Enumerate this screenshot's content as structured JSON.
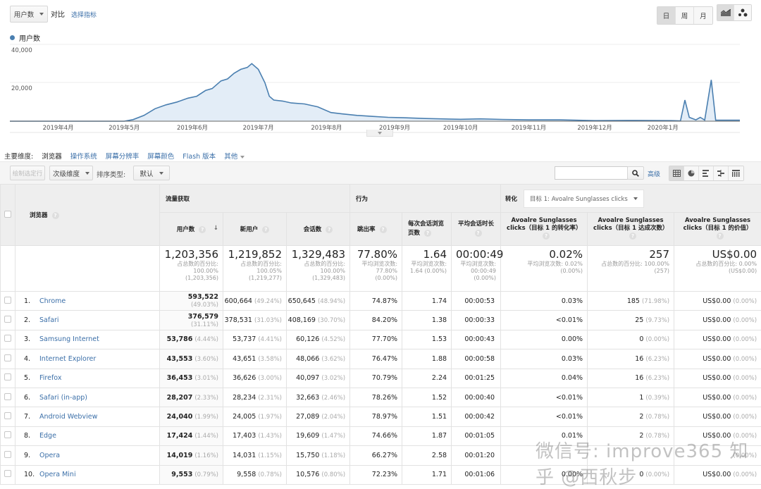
{
  "top": {
    "metric_select": "用户数",
    "compare_label": "对比",
    "select_metric_link": "选择指标",
    "period_buttons": [
      "日",
      "周",
      "月"
    ],
    "active_period": "日"
  },
  "legend": {
    "label": "用户数",
    "color": "#4a7fb0"
  },
  "chart_data": {
    "type": "area",
    "series": [
      {
        "name": "用户数",
        "color": "#4a7fb0"
      }
    ],
    "y_ticks": [
      "40,000",
      "20,000"
    ],
    "ylim": [
      0,
      40000
    ],
    "x_tick_labels": [
      "2019年4月",
      "2019年5月",
      "2019年6月",
      "2019年7月",
      "2019年8月",
      "2019年9月",
      "2019年10月",
      "2019年11月",
      "2019年12月",
      "2020年1月"
    ],
    "x_start": "2019-03-10",
    "x_end": "2020-02-05",
    "points": [
      [
        "2019-03-10",
        0
      ],
      [
        "2019-04-01",
        0
      ],
      [
        "2019-05-01",
        0
      ],
      [
        "2019-05-05",
        800
      ],
      [
        "2019-05-10",
        3000
      ],
      [
        "2019-05-15",
        6500
      ],
      [
        "2019-05-20",
        8500
      ],
      [
        "2019-05-25",
        10000
      ],
      [
        "2019-05-30",
        12000
      ],
      [
        "2019-06-03",
        13000
      ],
      [
        "2019-06-07",
        16000
      ],
      [
        "2019-06-10",
        17000
      ],
      [
        "2019-06-14",
        21000
      ],
      [
        "2019-06-17",
        22000
      ],
      [
        "2019-06-20",
        25000
      ],
      [
        "2019-06-23",
        27000
      ],
      [
        "2019-06-26",
        28000
      ],
      [
        "2019-06-28",
        30000
      ],
      [
        "2019-07-01",
        27000
      ],
      [
        "2019-07-04",
        20000
      ],
      [
        "2019-07-06",
        13000
      ],
      [
        "2019-07-08",
        11000
      ],
      [
        "2019-07-12",
        10500
      ],
      [
        "2019-07-16",
        9500
      ],
      [
        "2019-07-22",
        9000
      ],
      [
        "2019-07-28",
        7500
      ],
      [
        "2019-08-03",
        4500
      ],
      [
        "2019-08-08",
        3800
      ],
      [
        "2019-08-15",
        3000
      ],
      [
        "2019-08-22",
        2500
      ],
      [
        "2019-08-29",
        2000
      ],
      [
        "2019-09-05",
        1800
      ],
      [
        "2019-09-15",
        1400
      ],
      [
        "2019-10-01",
        1000
      ],
      [
        "2019-10-10",
        1200
      ],
      [
        "2019-10-20",
        900
      ],
      [
        "2019-11-01",
        700
      ],
      [
        "2019-11-15",
        700
      ],
      [
        "2019-12-01",
        300
      ],
      [
        "2019-12-20",
        400
      ],
      [
        "2020-01-05",
        300
      ],
      [
        "2020-01-09",
        200
      ],
      [
        "2020-01-11",
        11000
      ],
      [
        "2020-01-13",
        2000
      ],
      [
        "2020-01-16",
        700
      ],
      [
        "2020-01-18",
        2000
      ],
      [
        "2020-01-20",
        600
      ],
      [
        "2020-01-23",
        21500
      ],
      [
        "2020-01-25",
        500
      ],
      [
        "2020-02-05",
        500
      ]
    ]
  },
  "dimensions": {
    "label": "主要维度:",
    "items": [
      "浏览器",
      "操作系统",
      "屏幕分辨率",
      "屏幕颜色",
      "Flash 版本",
      "其他"
    ],
    "active": "浏览器"
  },
  "toolbar": {
    "plot_rows": "绘制选定行",
    "secondary_dim": "次级维度",
    "sort_label": "排序类型:",
    "sort_value": "默认",
    "search_placeholder": "",
    "advanced": "高级"
  },
  "table": {
    "dimension_header": "浏览器",
    "groups": {
      "acquisition": "流量获取",
      "behavior": "行为",
      "conversion": "转化",
      "goal_select": "目标 1: Avoalre Sunglasses clicks"
    },
    "columns": [
      "用户数",
      "新用户",
      "会话数",
      "跳出率",
      "每次会话浏览页数",
      "平均会话时长",
      "Avoalre Sunglasses clicks（目标 1 的转化率）",
      "Avoalre Sunglasses clicks（目标 1 达成次数）",
      "Avoalre Sunglasses clicks（目标 1 的价值）"
    ],
    "totals": [
      {
        "main": "1,203,356",
        "sub": "占总数的百分比: 100.00% (1,203,356)"
      },
      {
        "main": "1,219,852",
        "sub": "占总数的百分比: 100.05% (1,219,277)"
      },
      {
        "main": "1,329,483",
        "sub": "占总数的百分比: 100.00% (1,329,483)"
      },
      {
        "main": "77.80%",
        "sub": "平均浏览次数: 77.80% (0.00%)"
      },
      {
        "main": "1.64",
        "sub": "平均浏览次数: 1.64 (0.00%)"
      },
      {
        "main": "00:00:49",
        "sub": "平均浏览次数: 00:00:49 (0.00%)"
      },
      {
        "main": "0.02%",
        "sub": "平均浏览次数: 0.02% (0.00%)"
      },
      {
        "main": "257",
        "sub": "占总数的百分比: 100.00% (257)"
      },
      {
        "main": "US$0.00",
        "sub": "占总数的百分比: 0.00% (US$0.00)"
      }
    ],
    "rows": [
      {
        "rank": "1.",
        "browser": "Chrome",
        "users": "593,522",
        "users_pct": "(49.03%)",
        "new_users": "600,664",
        "new_users_pct": "(49.24%)",
        "sessions": "650,645",
        "sessions_pct": "(48.94%)",
        "bounce": "74.87%",
        "pages": "1.74",
        "duration": "00:00:53",
        "conv_rate": "0.03%",
        "completions": "185",
        "completions_pct": "(71.98%)",
        "value": "US$0.00",
        "value_pct": "(0.00%)"
      },
      {
        "rank": "2.",
        "browser": "Safari",
        "users": "376,579",
        "users_pct": "(31.11%)",
        "new_users": "378,531",
        "new_users_pct": "(31.03%)",
        "sessions": "408,169",
        "sessions_pct": "(30.70%)",
        "bounce": "84.20%",
        "pages": "1.38",
        "duration": "00:00:33",
        "conv_rate": "<0.01%",
        "completions": "25",
        "completions_pct": "(9.73%)",
        "value": "US$0.00",
        "value_pct": "(0.00%)"
      },
      {
        "rank": "3.",
        "browser": "Samsung Internet",
        "users": "53,786",
        "users_pct": "(4.44%)",
        "new_users": "53,737",
        "new_users_pct": "(4.41%)",
        "sessions": "60,126",
        "sessions_pct": "(4.52%)",
        "bounce": "77.70%",
        "pages": "1.53",
        "duration": "00:00:43",
        "conv_rate": "0.00%",
        "completions": "0",
        "completions_pct": "(0.00%)",
        "value": "US$0.00",
        "value_pct": "(0.00%)"
      },
      {
        "rank": "4.",
        "browser": "Internet Explorer",
        "users": "43,553",
        "users_pct": "(3.60%)",
        "new_users": "43,651",
        "new_users_pct": "(3.58%)",
        "sessions": "48,066",
        "sessions_pct": "(3.62%)",
        "bounce": "76.47%",
        "pages": "1.88",
        "duration": "00:00:58",
        "conv_rate": "0.03%",
        "completions": "16",
        "completions_pct": "(6.23%)",
        "value": "US$0.00",
        "value_pct": "(0.00%)"
      },
      {
        "rank": "5.",
        "browser": "Firefox",
        "users": "36,453",
        "users_pct": "(3.01%)",
        "new_users": "36,626",
        "new_users_pct": "(3.00%)",
        "sessions": "40,097",
        "sessions_pct": "(3.02%)",
        "bounce": "70.79%",
        "pages": "2.24",
        "duration": "00:01:25",
        "conv_rate": "0.04%",
        "completions": "16",
        "completions_pct": "(6.23%)",
        "value": "US$0.00",
        "value_pct": "(0.00%)"
      },
      {
        "rank": "6.",
        "browser": "Safari (in-app)",
        "users": "28,207",
        "users_pct": "(2.33%)",
        "new_users": "28,234",
        "new_users_pct": "(2.31%)",
        "sessions": "32,663",
        "sessions_pct": "(2.46%)",
        "bounce": "78.26%",
        "pages": "1.52",
        "duration": "00:00:40",
        "conv_rate": "<0.01%",
        "completions": "1",
        "completions_pct": "(0.39%)",
        "value": "US$0.00",
        "value_pct": "(0.00%)"
      },
      {
        "rank": "7.",
        "browser": "Android Webview",
        "users": "24,040",
        "users_pct": "(1.99%)",
        "new_users": "24,005",
        "new_users_pct": "(1.97%)",
        "sessions": "27,089",
        "sessions_pct": "(2.04%)",
        "bounce": "78.97%",
        "pages": "1.51",
        "duration": "00:00:42",
        "conv_rate": "<0.01%",
        "completions": "2",
        "completions_pct": "(0.78%)",
        "value": "US$0.00",
        "value_pct": "(0.00%)"
      },
      {
        "rank": "8.",
        "browser": "Edge",
        "users": "17,424",
        "users_pct": "(1.44%)",
        "new_users": "17,403",
        "new_users_pct": "(1.43%)",
        "sessions": "19,609",
        "sessions_pct": "(1.47%)",
        "bounce": "74.66%",
        "pages": "1.87",
        "duration": "00:01:05",
        "conv_rate": "0.01%",
        "completions": "2",
        "completions_pct": "(0.78%)",
        "value": "US$0.00",
        "value_pct": "(0.00%)"
      },
      {
        "rank": "9.",
        "browser": "Opera",
        "users": "14,019",
        "users_pct": "(1.16%)",
        "new_users": "14,031",
        "new_users_pct": "(1.15%)",
        "sessions": "15,750",
        "sessions_pct": "(1.18%)",
        "bounce": "66.27%",
        "pages": "2.58",
        "duration": "00:01:20",
        "conv_rate": "",
        "completions": "",
        "completions_pct": "",
        "value": "",
        "value_pct": "(0.00%)"
      },
      {
        "rank": "10.",
        "browser": "Opera Mini",
        "users": "9,553",
        "users_pct": "(0.79%)",
        "new_users": "9,558",
        "new_users_pct": "(0.78%)",
        "sessions": "10,576",
        "sessions_pct": "(0.80%)",
        "bounce": "72.23%",
        "pages": "1.71",
        "duration": "00:01:06",
        "conv_rate": "0.00%",
        "completions": "0",
        "completions_pct": "(0.00%)",
        "value": "US$0.00",
        "value_pct": "(0.00%)"
      }
    ]
  },
  "watermark": "微信号: improve365 知乎 @西秋步"
}
